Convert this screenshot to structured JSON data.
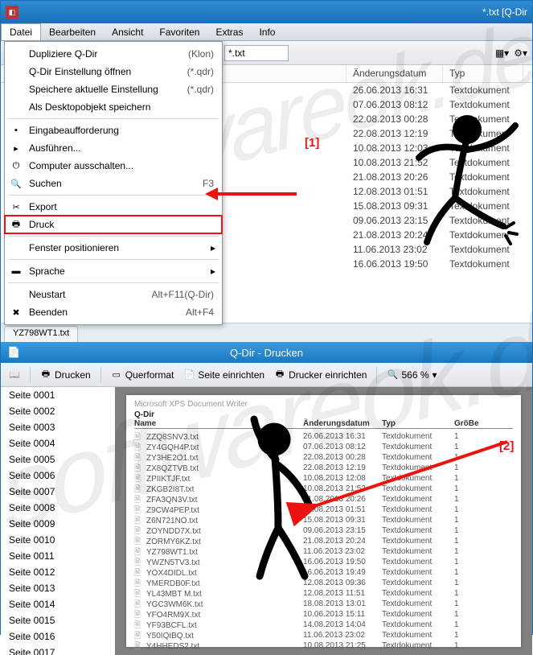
{
  "window": {
    "title": "*.txt  [Q-Dir"
  },
  "menus": [
    "Datei",
    "Bearbeiten",
    "Ansicht",
    "Favoriten",
    "Extras",
    "Info"
  ],
  "toolbar": {
    "filter": "*.txt"
  },
  "dropdown": {
    "items": [
      {
        "label": "Dupliziere Q-Dir",
        "accel": "(Klon)",
        "icon": ""
      },
      {
        "label": "Q-Dir Einstellung öffnen",
        "accel": "(*.qdr)",
        "icon": ""
      },
      {
        "label": "Speichere  aktuelle Einstellung",
        "accel": "(*.qdr)",
        "icon": ""
      },
      {
        "label": "Als Desktopobjekt speichern",
        "accel": "",
        "icon": ""
      }
    ],
    "items2": [
      {
        "label": "Eingabeaufforderung",
        "icon": "cmd"
      },
      {
        "label": "Ausführen...",
        "icon": "run"
      },
      {
        "label": "Computer ausschalten...",
        "icon": "power"
      },
      {
        "label": "Suchen",
        "accel": "F3",
        "icon": "search"
      }
    ],
    "items3": [
      {
        "label": "Export",
        "icon": "export"
      },
      {
        "label": "Druck",
        "icon": "print",
        "highlight": true
      }
    ],
    "items4": [
      {
        "label": "Fenster positionieren",
        "arrow": true
      }
    ],
    "items5": [
      {
        "label": "Sprache",
        "icon": "flag",
        "arrow": true
      }
    ],
    "items6": [
      {
        "label": "Neustart",
        "accel": "Alt+F11(Q-Dir)"
      },
      {
        "label": "Beenden",
        "accel": "Alt+F4",
        "icon": "close"
      }
    ]
  },
  "filepane": {
    "cols": {
      "date": "Änderungsdatum",
      "typ": "Typ"
    },
    "rows": [
      {
        "d": "26.06.2013 16:31",
        "t": "Textdokument"
      },
      {
        "d": "07.06.2013 08:12",
        "t": "Textdokument"
      },
      {
        "d": "22.08.2013 00:28",
        "t": "Textdokument"
      },
      {
        "d": "22.08.2013 12:19",
        "t": "Textdokument"
      },
      {
        "d": "10.08.2013 12:03",
        "t": "Textdokument"
      },
      {
        "d": "10.08.2013 21:52",
        "t": "Textdokument"
      },
      {
        "d": "21.08.2013 20:26",
        "t": "Textdokument"
      },
      {
        "d": "12.08.2013 01:51",
        "t": "Textdokument"
      },
      {
        "d": "15.08.2013 09:31",
        "t": "Textdokument"
      },
      {
        "d": "09.06.2013 23:15",
        "t": "Textdokument"
      },
      {
        "d": "21.08.2013 20:24",
        "t": "Textdokument"
      },
      {
        "d": "11.06.2013 23:02",
        "t": "Textdokument"
      },
      {
        "d": "16.06.2013 19:50",
        "t": "Textdokument"
      }
    ]
  },
  "tab": "YZ798WT1.txt",
  "print": {
    "title": "Q-Dir - Drucken",
    "buttons": {
      "print": "Drucken",
      "landscape": "Querformat",
      "pagesetup": "Seite einrichten",
      "printersetup": "Drucker einrichten",
      "zoom": "566 %"
    },
    "pages_prefix": "Seite ",
    "pages": [
      "0001",
      "0002",
      "0003",
      "0004",
      "0005",
      "0006",
      "0007",
      "0008",
      "0009",
      "0010",
      "0011",
      "0012",
      "0013",
      "0014",
      "0015",
      "0016",
      "0017"
    ],
    "preview": {
      "driver": "Microsoft XPS Document Writer",
      "heading": "Q-Dir",
      "cols": {
        "name": "Name",
        "date": "Änderungsdatum",
        "typ": "Typ",
        "size": "GröBe"
      },
      "rows": [
        {
          "n": "ZZQ8SNV3.txt",
          "d": "26.06.2013  16:31",
          "t": "Textdokument",
          "s": "1"
        },
        {
          "n": "ZY4GQH4P.txt",
          "d": "07.06.2013  08:12",
          "t": "Textdokument",
          "s": "1"
        },
        {
          "n": "ZY3HE2O1.txt",
          "d": "22.08.2013  00:28",
          "t": "Textdokument",
          "s": "1"
        },
        {
          "n": "ZX8QZTVB.txt",
          "d": "22.08.2013  12:19",
          "t": "Textdokument",
          "s": "1"
        },
        {
          "n": "ZPIIKTJF.txt",
          "d": "10.08.2013  12:08",
          "t": "Textdokument",
          "s": "1"
        },
        {
          "n": "ZKGB2I8T.txt",
          "d": "10.08.2013  21:52",
          "t": "Textdokument",
          "s": "1"
        },
        {
          "n": "ZFA3QN3V.txt",
          "d": "21.08.2013  20:26",
          "t": "Textdokument",
          "s": "1"
        },
        {
          "n": "Z9CW4PEP.txt",
          "d": "12.08.2013  01:51",
          "t": "Textdokument",
          "s": "1"
        },
        {
          "n": "Z6N721NO.txt",
          "d": "15.08.2013  09:31",
          "t": "Textdokument",
          "s": "1"
        },
        {
          "n": "ZOYNDD7X.txt",
          "d": "09.06.2013  23:15",
          "t": "Textdokument",
          "s": "1"
        },
        {
          "n": "ZORMY6KZ.txt",
          "d": "21.08.2013  20:24",
          "t": "Textdokument",
          "s": "1"
        },
        {
          "n": "YZ798WT1.txt",
          "d": "11.06.2013  23:02",
          "t": "Textdokument",
          "s": "1"
        },
        {
          "n": "YWZN5TV3.txt",
          "d": "16.06.2013  19:50",
          "t": "Textdokument",
          "s": "1"
        },
        {
          "n": "YOX4DIDL.txt",
          "d": "16.06.2013  19:49",
          "t": "Textdokument",
          "s": "1"
        },
        {
          "n": "YMERDB0F.txt",
          "d": "12.08.2013  09:36",
          "t": "Textdokument",
          "s": "1"
        },
        {
          "n": "YL43MBT M.txt",
          "d": "12.08.2013  11:51",
          "t": "Textdokument",
          "s": "1"
        },
        {
          "n": "YGC3WM6K.txt",
          "d": "18.08.2013  13:01",
          "t": "Textdokument",
          "s": "1"
        },
        {
          "n": "YFO4RM9X.txt",
          "d": "10.06.2013  15:11",
          "t": "Textdokument",
          "s": "1"
        },
        {
          "n": "YF93BCFL.txt",
          "d": "14.08.2013  14:04",
          "t": "Textdokument",
          "s": "1"
        },
        {
          "n": "Y50IQIBQ.txt",
          "d": "11.06.2013  23:02",
          "t": "Textdokument",
          "s": "1"
        },
        {
          "n": "Y4HHEDS2.txt",
          "d": "10.08.2013  21:25",
          "t": "Textdokument",
          "s": "1"
        }
      ]
    }
  },
  "anno": {
    "l1": "[1]",
    "l2": "[2]"
  }
}
